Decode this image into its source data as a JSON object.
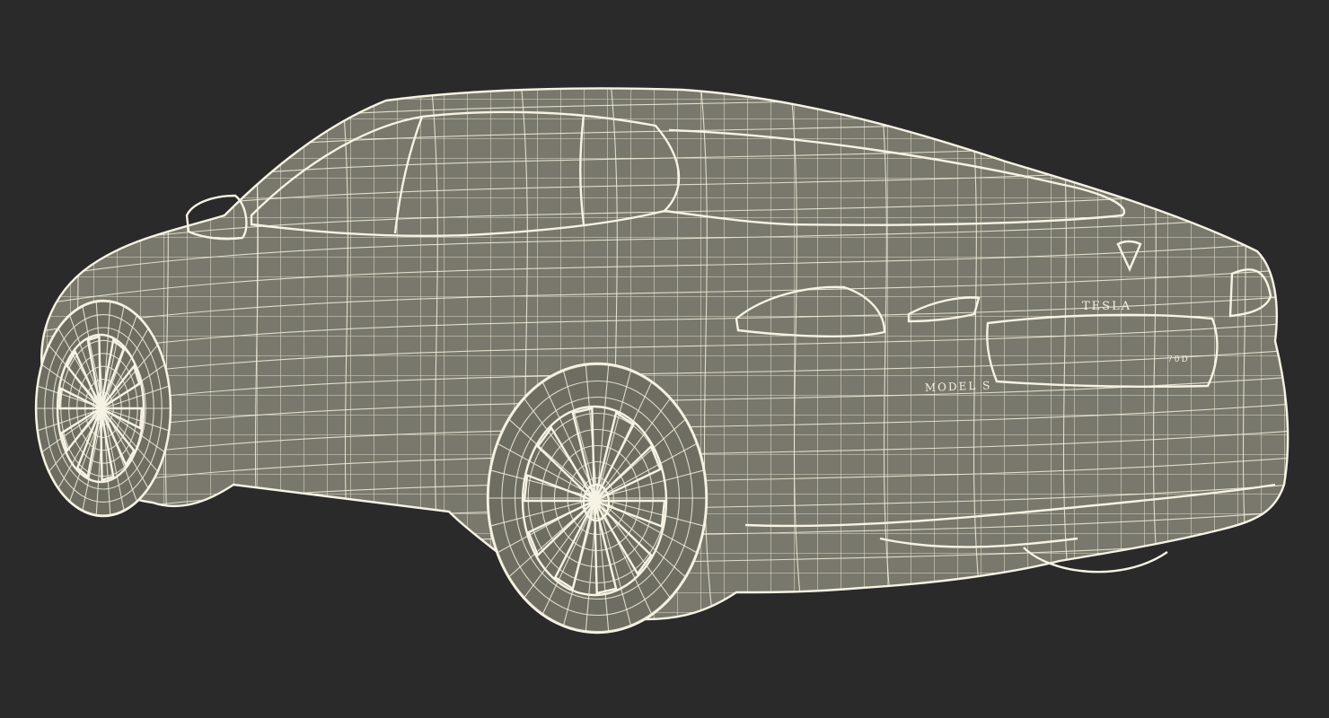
{
  "scene": {
    "background_color": "#2a2a2a",
    "mesh_color": "#f1eedc",
    "surface_color": "#7a7a6e",
    "subject": "car-wireframe-render"
  },
  "badges": {
    "brand_text": "TESLA",
    "model_text": "MODEL S",
    "variant_text": "70D"
  }
}
